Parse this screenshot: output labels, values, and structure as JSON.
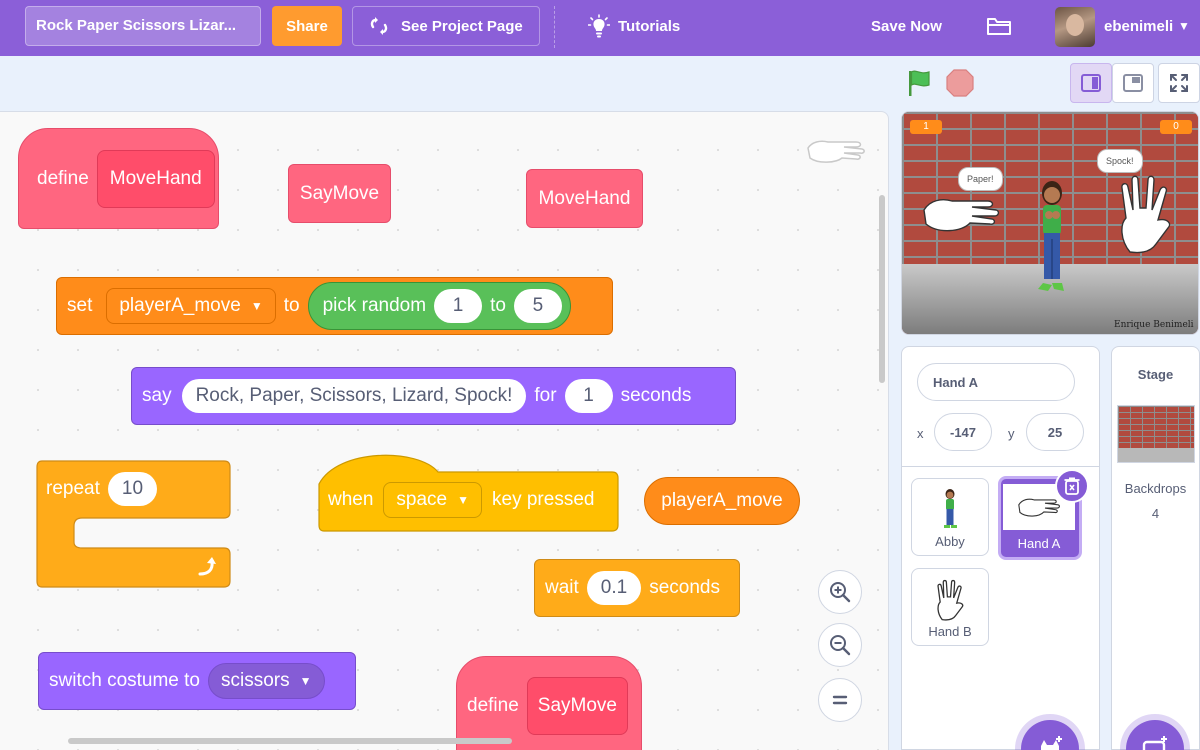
{
  "menu": {
    "project_title": "Rock Paper Scissors Lizar...",
    "share_label": "Share",
    "see_project_label": "See Project Page",
    "tutorials_label": "Tutorials",
    "save_now_label": "Save Now",
    "username": "ebenimeli"
  },
  "blocks": {
    "define_movehand": {
      "keyword": "define",
      "name": "MoveHand"
    },
    "saymove_call": "SayMove",
    "movehand_call": "MoveHand",
    "set_var": {
      "keyword": "set",
      "variable": "playerA_move",
      "to": "to",
      "pick_random": "pick random",
      "from": "1",
      "and": "to",
      "max": "5"
    },
    "say_for": {
      "keyword": "say",
      "message": "Rock, Paper, Scissors, Lizard, Spock!",
      "for": "for",
      "secs": "1",
      "unit": "seconds"
    },
    "repeat": {
      "keyword": "repeat",
      "times": "10"
    },
    "when_key": {
      "when": "when",
      "key": "space",
      "pressed": "key pressed"
    },
    "variable_reporter": "playerA_move",
    "wait": {
      "keyword": "wait",
      "secs": "0.1",
      "unit": "seconds"
    },
    "switch_costume": {
      "keyword": "switch costume to",
      "costume": "scissors"
    },
    "define_saymove": {
      "keyword": "define",
      "name": "SayMove"
    }
  },
  "stage": {
    "monitor_left": "1",
    "monitor_right": "0",
    "bubble_left": "Paper!",
    "bubble_right": "Spock!",
    "credit": "Enrique Benimeli"
  },
  "sprite_info": {
    "name": "Hand A",
    "x_label": "x",
    "x": "-147",
    "y_label": "y",
    "y": "25"
  },
  "sprites": [
    {
      "name": "Abby",
      "selected": false
    },
    {
      "name": "Hand A",
      "selected": true
    },
    {
      "name": "Hand B",
      "selected": false
    }
  ],
  "stage_target": {
    "title": "Stage",
    "backdrops_label": "Backdrops",
    "backdrops_count": "4"
  },
  "colors": {
    "menu_bar": "#8b5fd8",
    "share": "#ff9b2f",
    "my_blocks": "#ff6680",
    "variables": "#ff8c1a",
    "looks": "#9966ff",
    "operators": "#59c059",
    "events": "#ffbf00",
    "control": "#ffab19"
  }
}
